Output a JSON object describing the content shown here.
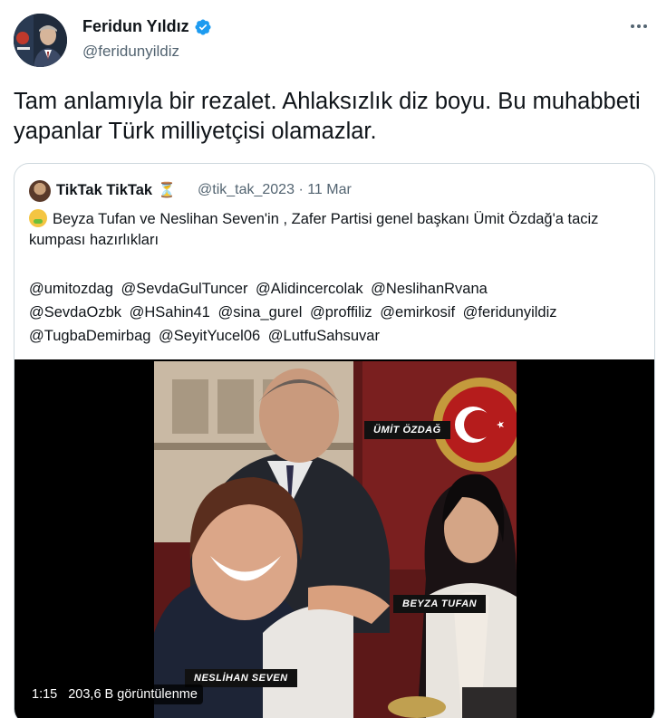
{
  "author": {
    "name": "Feridun Yıldız",
    "handle": "@feridunyildiz",
    "verified": true
  },
  "tweet_text": "Tam anlamıyla bir rezalet. Ahlaksızlık diz boyu. Bu muhabbeti yapanlar Türk milliyetçisi olamazlar.",
  "quote": {
    "name": "TikTak TikTak",
    "handle": "@tik_tak_2023",
    "separator": "·",
    "date": "11 Mar",
    "text": "Beyza Tufan ve Neslihan Seven'in , Zafer Partisi genel başkanı Ümit Özdağ'a taciz kumpası hazırlıkları",
    "mentions": [
      "@umitozdag",
      "@SevdaGulTuncer",
      "@Alidincercolak",
      "@NeslihanRvana",
      "@SevdaOzbk",
      "@HSahin41",
      "@sina_gurel",
      "@proffiliz",
      "@emirkosif",
      "@feridunyildiz",
      "@TugbaDemirbag",
      "@SeyitYucel06",
      "@LutfuSahsuvar"
    ]
  },
  "media": {
    "labels": {
      "top": "ÜMİT ÖZDAĞ",
      "right": "BEYZA TUFAN",
      "bottom": "NESLİHAN SEVEN"
    },
    "duration": "1:15",
    "views": "203,6 B görüntülenme"
  },
  "icons": {
    "verified": "verified-badge-icon",
    "more": "more-options-icon",
    "hourglass": "hourglass-icon"
  },
  "colors": {
    "text": "#0f1419",
    "secondary": "#536471",
    "verified": "#1d9bf0",
    "border": "#cfd9de"
  }
}
